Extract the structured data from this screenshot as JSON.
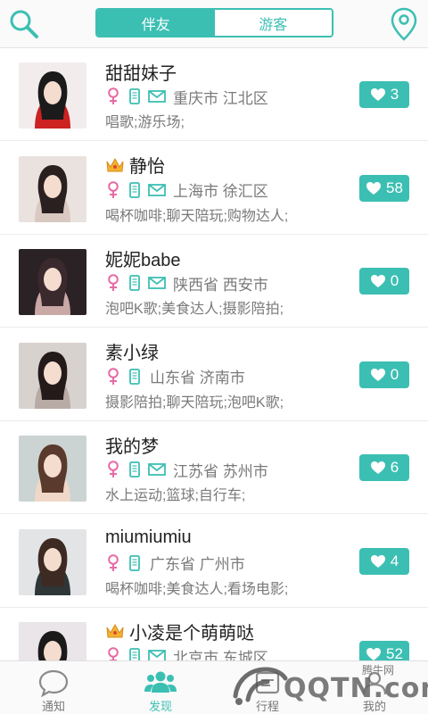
{
  "header": {
    "tabs": [
      {
        "label": "伴友",
        "active": true
      },
      {
        "label": "游客",
        "active": false
      }
    ],
    "search_icon": "search-icon",
    "location_icon": "location-pin-icon"
  },
  "colors": {
    "accent": "#3cbfb3",
    "female": "#e86aa5",
    "icon_teal": "#3cbfb3"
  },
  "users": [
    {
      "name": "甜甜妹子",
      "crown": false,
      "location": "重庆市 江北区",
      "hobbies": "唱歌;游乐场;",
      "likes": "3",
      "phone": true,
      "mail": true
    },
    {
      "name": "静怡",
      "crown": true,
      "location": "上海市 徐汇区",
      "hobbies": "喝杯咖啡;聊天陪玩;购物达人;",
      "likes": "58",
      "phone": true,
      "mail": true
    },
    {
      "name": "妮妮babe",
      "crown": false,
      "location": "陕西省 西安市",
      "hobbies": "泡吧K歌;美食达人;摄影陪拍;",
      "likes": "0",
      "phone": true,
      "mail": true
    },
    {
      "name": "素小绿",
      "crown": false,
      "location": "山东省 济南市",
      "hobbies": "摄影陪拍;聊天陪玩;泡吧K歌;",
      "likes": "0",
      "phone": true,
      "mail": false
    },
    {
      "name": "我的梦",
      "crown": false,
      "location": "江苏省 苏州市",
      "hobbies": "水上运动;篮球;自行车;",
      "likes": "6",
      "phone": true,
      "mail": true
    },
    {
      "name": "miumiumiu",
      "crown": false,
      "location": "广东省 广州市",
      "hobbies": "喝杯咖啡;美食达人;看场电影;",
      "likes": "4",
      "phone": true,
      "mail": false
    },
    {
      "name": "小凌是个萌萌哒",
      "crown": true,
      "location": "北京市 东城区",
      "hobbies": "",
      "likes": "52",
      "phone": true,
      "mail": true
    }
  ],
  "tabbar": {
    "items": [
      {
        "label": "通知",
        "icon": "chat-bubble-icon",
        "active": false
      },
      {
        "label": "发现",
        "icon": "people-icon",
        "active": true
      },
      {
        "label": "行程",
        "icon": "itinerary-icon",
        "active": false
      },
      {
        "label": "我的",
        "icon": "profile-icon",
        "active": false
      }
    ]
  },
  "watermark": {
    "brand": "QQTN.com",
    "sub": "腾牛网"
  }
}
